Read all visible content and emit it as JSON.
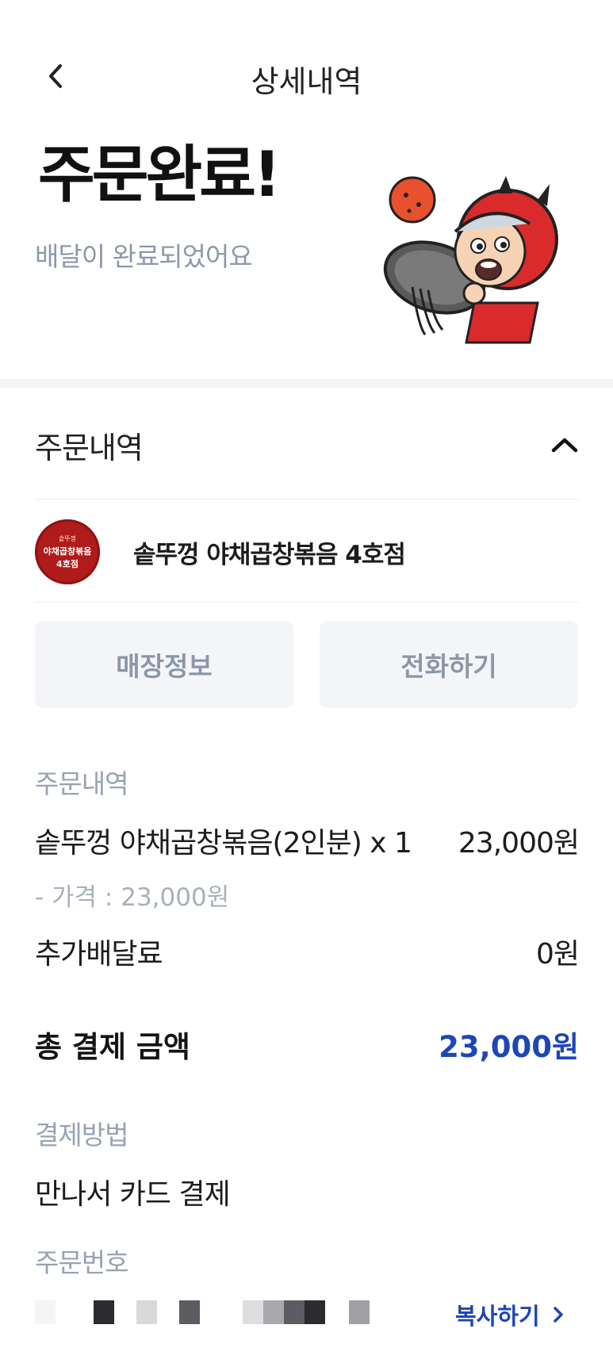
{
  "header": {
    "title": "상세내역",
    "back_icon": "chevron-left-icon"
  },
  "hero": {
    "title": "주문완료!",
    "subtitle": "배달이 완료되었어요",
    "mascot": "delivery-mascot-illustration"
  },
  "order_section": {
    "title": "주문내역",
    "toggle_icon": "chevron-up-icon"
  },
  "store": {
    "name": "솥뚜껑 야채곱창볶음 4호점",
    "logo_top": "솥뚜껑",
    "logo_mid": "야채곱창볶음",
    "logo_bottom": "4호점",
    "logo_color": "#b01b1b"
  },
  "buttons": {
    "store_info": "매장정보",
    "call": "전화하기"
  },
  "order_details": {
    "label": "주문내역",
    "item_name": "솥뚜껑 야채곱창볶음(2인분) x 1",
    "item_price": "23,000원",
    "item_price_detail": "- 가격 : 23,000원",
    "extra_fee_label": "추가배달료",
    "extra_fee_value": "0원"
  },
  "total": {
    "label": "총 결제 금액",
    "amount": "23,000원",
    "accent_color": "#1e46b6"
  },
  "payment": {
    "label": "결제방법",
    "method": "만나서 카드 결제"
  },
  "order_number": {
    "label": "주문번호",
    "copy_label": "복사하기",
    "copy_icon": "chevron-right-icon"
  }
}
